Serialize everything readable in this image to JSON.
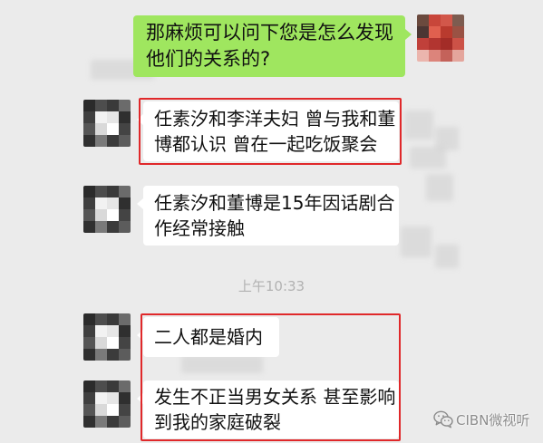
{
  "colors": {
    "background": "#ebebeb",
    "sent_bubble": "#9fe65f",
    "received_bubble": "#ffffff",
    "highlight_border": "#e0282a",
    "timestamp_text": "#b2b2b2"
  },
  "messages": [
    {
      "side": "sent",
      "highlighted": false,
      "lines": [
        "那麻烦可以问下您是怎么发现",
        "他们的关系的?"
      ]
    },
    {
      "side": "received",
      "highlighted": true,
      "lines": [
        "任素汐和李洋夫妇 曾与我和董",
        "博都认识 曾在一起吃饭聚会"
      ]
    },
    {
      "side": "received",
      "highlighted": false,
      "lines": [
        "任素汐和董博是15年因话剧合",
        "作经常接触"
      ]
    },
    {
      "side": "received",
      "highlighted": true,
      "lines": [
        "二人都是婚内"
      ]
    },
    {
      "side": "received",
      "highlighted": true,
      "lines": [
        "发生不正当男女关系 甚至影响",
        "到我的家庭破裂"
      ]
    }
  ],
  "timestamp": "上午10:33",
  "watermark": {
    "icon": "wechat-icon",
    "text": "CIBN微视听"
  }
}
